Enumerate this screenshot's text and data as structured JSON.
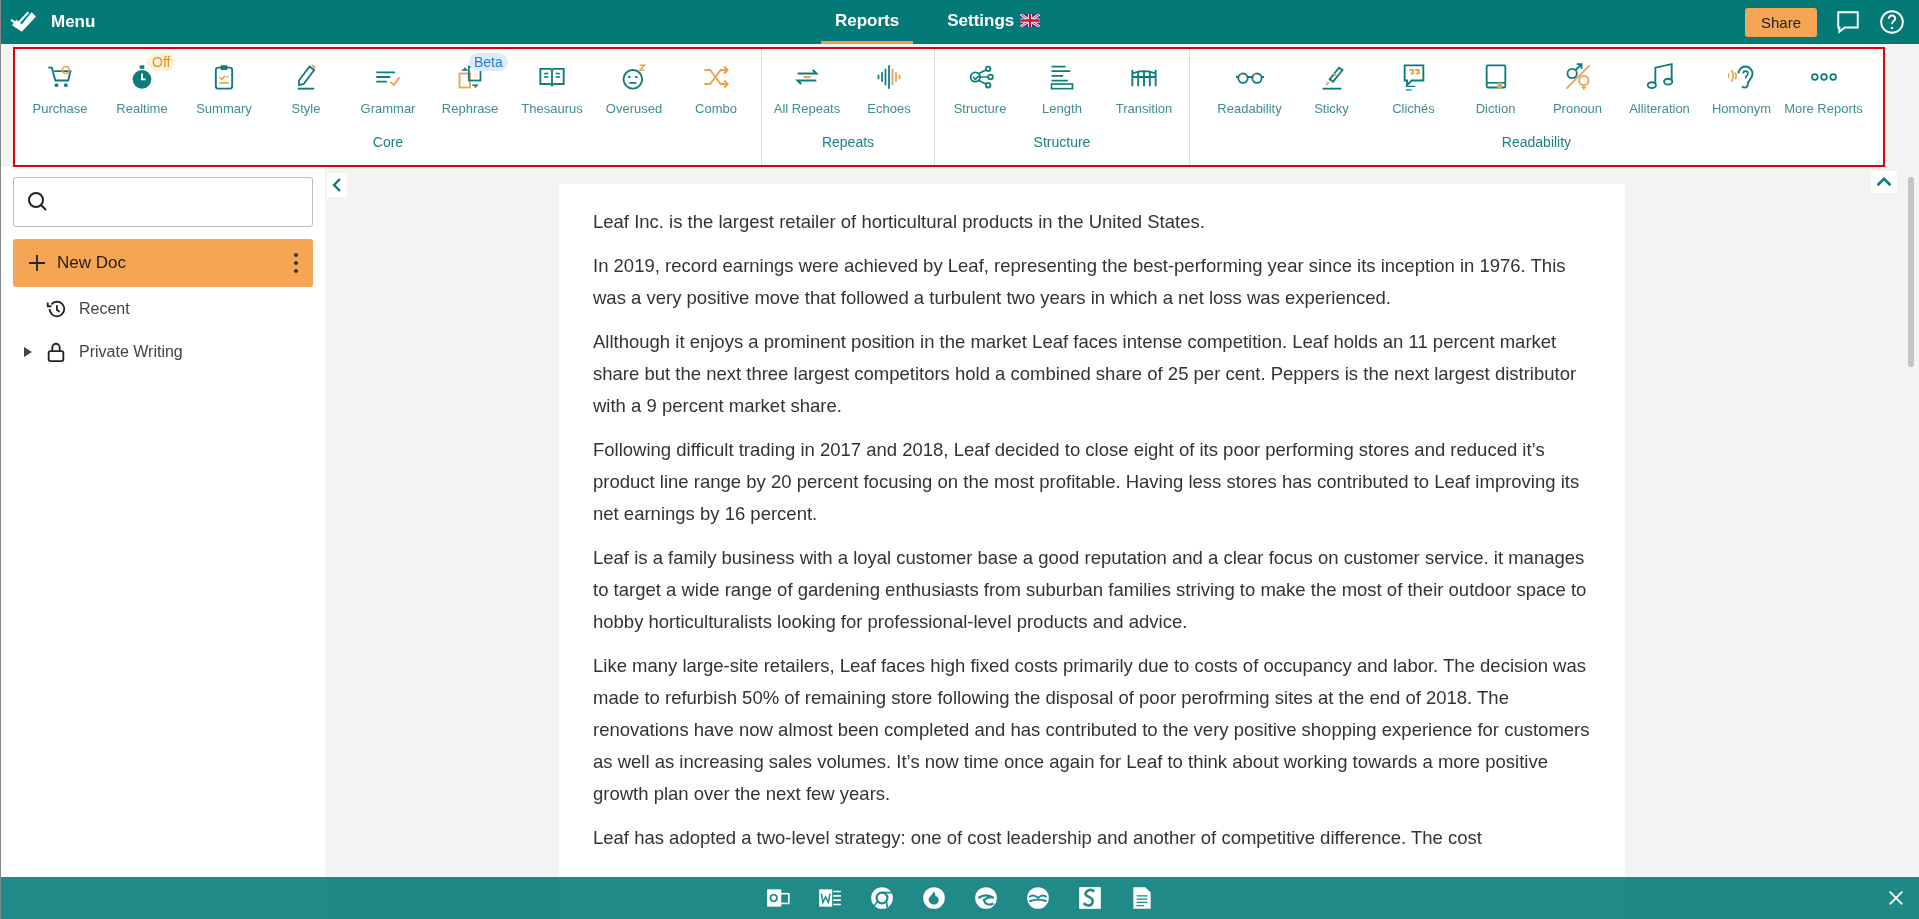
{
  "topbar": {
    "menu": "Menu",
    "tabs": [
      {
        "label": "Reports",
        "selected": true
      },
      {
        "label": "Settings",
        "selected": false
      }
    ],
    "share": "Share"
  },
  "toolbar": {
    "groups": [
      {
        "title": "Core",
        "items": [
          {
            "label": "Purchase"
          },
          {
            "label": "Realtime",
            "badge": "Off",
            "kind": "off"
          },
          {
            "label": "Summary"
          },
          {
            "label": "Style"
          },
          {
            "label": "Grammar"
          },
          {
            "label": "Rephrase",
            "badge": "Beta",
            "kind": "beta"
          },
          {
            "label": "Thesaurus"
          },
          {
            "label": "Overused"
          },
          {
            "label": "Combo"
          }
        ]
      },
      {
        "title": "Repeats",
        "items": [
          {
            "label": "All Repeats"
          },
          {
            "label": "Echoes"
          }
        ]
      },
      {
        "title": "Structure",
        "items": [
          {
            "label": "Structure"
          },
          {
            "label": "Length"
          },
          {
            "label": "Transition"
          }
        ]
      },
      {
        "title": "Readability",
        "items": [
          {
            "label": "Readability"
          },
          {
            "label": "Sticky"
          },
          {
            "label": "Clichés"
          },
          {
            "label": "Diction"
          },
          {
            "label": "Pronoun"
          },
          {
            "label": "Alliteration"
          },
          {
            "label": "Homonym"
          },
          {
            "label": "More Reports"
          }
        ]
      }
    ]
  },
  "sidebar": {
    "new_doc": "New Doc",
    "items": [
      {
        "label": "Recent",
        "expandable": false
      },
      {
        "label": "Private Writing",
        "expandable": true
      }
    ]
  },
  "document": {
    "paragraphs": [
      "Leaf Inc. is the largest retailer of horticultural products in the United States.",
      "In 2019, record earnings were achieved by Leaf, representing the best-performing year since its inception in 1976. This was a very positive move that followed a turbulent two years in which a net loss was experienced.",
      "Allthough it enjoys a prominent position in the market Leaf faces intense competition. Leaf holds an 11 percent market share but the next three largest competitors hold a combined share of 25 per cent. Peppers is the next largest distributor with a 9 percent market share.",
      "Following difficult trading in 2017 and 2018, Leaf decided to close eight of its poor performing stores and reduced it’s product line range by 20 percent focusing on the most profitable. Having less stores has contributed to Leaf improving its net earnings by 16 percent.",
      "Leaf is a family business with a loyal customer base a good reputation and a clear focus on customer service. it manages to target a wide range of gardening enthusiasts from suburban families striving to make the most of their outdoor space to hobby horticulturalists looking for professional-level products and advice.",
      "Like many large-site retailers, Leaf faces high fixed costs primarily due to costs of occupancy and labor. The decision was made to refurbish 50% of remaining store following the disposal of poor perofrming sites at the end of 2018. The renovations have now almost been completed and has contributed to the very positive shopping experience for customers as well as increasing sales volumes. It’s now time once again for Leaf to think about working towards a more positive growth plan over the next few years.",
      "Leaf has adopted a two-level strategy: one of cost leadership and another of competitive difference.  The cost"
    ]
  }
}
